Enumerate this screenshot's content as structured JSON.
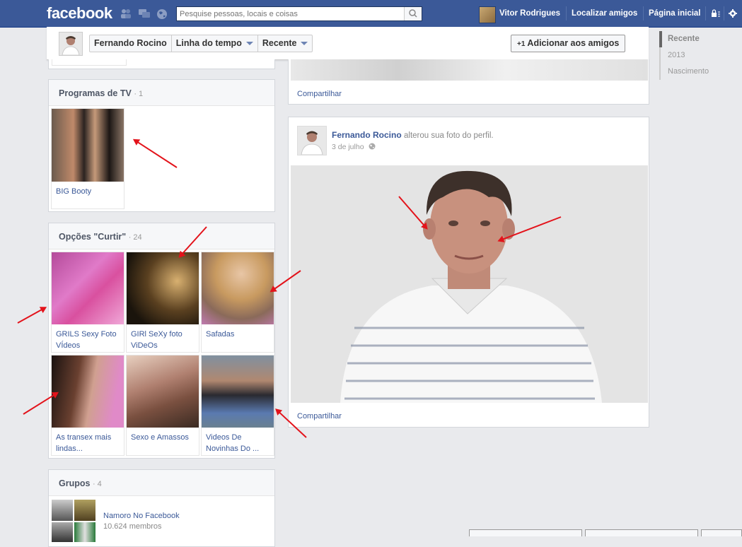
{
  "header": {
    "logo": "facebook",
    "search_placeholder": "Pesquise pessoas, locais e coisas",
    "user_name": "Vitor Rodrigues",
    "find_friends": "Localizar amigos",
    "home": "Página inicial"
  },
  "profile_bar": {
    "name": "Fernando Rocino",
    "timeline": "Linha do tempo",
    "recent": "Recente",
    "add_friend": "Adicionar aos amigos",
    "add_friend_prefix": "+1"
  },
  "timeline_nav": [
    "Recente",
    "2013",
    "Nascimento"
  ],
  "tv_box": {
    "title": "Programas de TV",
    "count": "· 1",
    "items": [
      {
        "label": "BIG Booty"
      }
    ]
  },
  "likes_box": {
    "title": "Opções \"Curtir\"",
    "count": "· 24",
    "items": [
      {
        "label": "GRILS Sexy Foto VÍdeos"
      },
      {
        "label": "GIRl SeXy foto ViDeOs"
      },
      {
        "label": "Safadas"
      },
      {
        "label": "As transex mais lindas..."
      },
      {
        "label": "Sexo e Amassos"
      },
      {
        "label": "Videos De Novinhas Do ..."
      }
    ]
  },
  "groups_box": {
    "title": "Grupos",
    "count": "· 4",
    "group_name": "Namoro No Facebook",
    "group_members": "10.624 membros"
  },
  "post_top": {
    "share": "Compartilhar"
  },
  "post_main": {
    "author": "Fernando Rocino",
    "action": "alterou sua foto do perfil.",
    "date": "3 de julho",
    "share": "Compartilhar"
  },
  "chat_tabs": [
    "",
    "",
    ""
  ],
  "colors": {
    "brand": "#3b5998",
    "annotation": "#e3131b"
  }
}
